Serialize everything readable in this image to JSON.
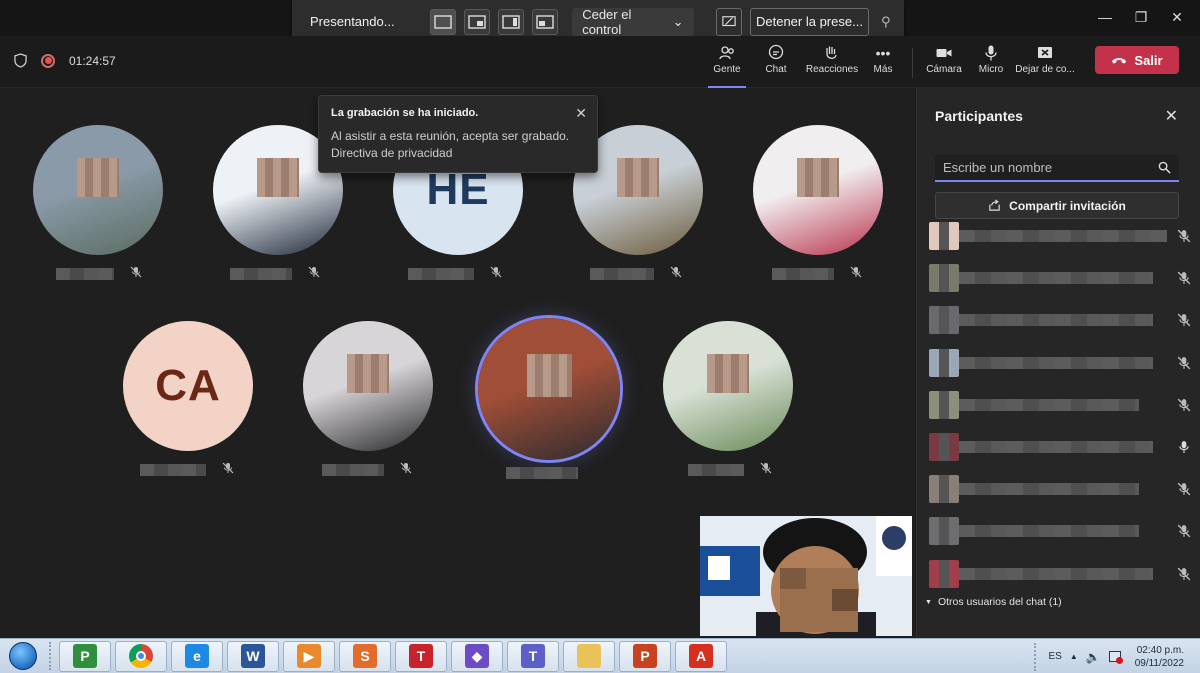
{
  "presenter_bar": {
    "presenting_label": "Presentando...",
    "give_control_label": "Ceder el control",
    "stop_label": "Detener la prese..."
  },
  "header": {
    "timer": "01:24:57",
    "tools": [
      {
        "label": "Gente",
        "icon": "people-icon"
      },
      {
        "label": "Chat",
        "icon": "chat-icon"
      },
      {
        "label": "Reacciones",
        "icon": "reactions-icon"
      },
      {
        "label": "Más",
        "icon": "more-icon"
      }
    ],
    "devices": [
      {
        "label": "Cámara",
        "icon": "camera-icon"
      },
      {
        "label": "Micro",
        "icon": "mic-icon"
      },
      {
        "label": "Dejar de co...",
        "icon": "stop-sharing-icon"
      }
    ],
    "leave_label": "Salir"
  },
  "toast": {
    "title": "La grabación se ha iniciado.",
    "body": "Al asistir a esta reunión, acepta ser grabado.",
    "link": "Directiva de privacidad"
  },
  "stage": {
    "tiles": [
      {
        "type": "photo",
        "colors": [
          "#8a9aa8",
          "#5a6b60"
        ]
      },
      {
        "type": "photo",
        "colors": [
          "#eef2f6",
          "#1d2638"
        ]
      },
      {
        "type": "initials",
        "initials": "HE",
        "bg": "#d9e4f1",
        "fg": "#203a5e"
      },
      {
        "type": "photo",
        "colors": [
          "#c9cfd6",
          "#6a5a3a"
        ]
      },
      {
        "type": "photo",
        "colors": [
          "#f1eef0",
          "#b8324b"
        ]
      },
      {
        "type": "initials",
        "initials": "CA",
        "bg": "#f2d3c5",
        "fg": "#6a2715"
      },
      {
        "type": "photo",
        "colors": [
          "#d8d5d8",
          "#262628"
        ]
      },
      {
        "type": "photo",
        "colors": [
          "#a04e37",
          "#2b2b2e"
        ]
      },
      {
        "type": "photo",
        "colors": [
          "#d9e1d6",
          "#6a8a58"
        ]
      }
    ]
  },
  "panel": {
    "title": "Participantes",
    "search_placeholder": "Escribe un nombre",
    "share_invite_label": "Compartir invitación",
    "participants": [
      {
        "avatar": "#e0c8bd",
        "mic": "off"
      },
      {
        "avatar": "#7a7a6a",
        "mic": "off"
      },
      {
        "avatar": "#6a6a6e",
        "mic": "off"
      },
      {
        "avatar": "#9aa8b6",
        "mic": "off"
      },
      {
        "avatar": "#8c8f7a",
        "mic": "off"
      },
      {
        "avatar": "#7a3a44",
        "mic": "on"
      },
      {
        "avatar": "#8a7f78",
        "mic": "off"
      },
      {
        "avatar": "#6e6e70",
        "mic": "off"
      },
      {
        "avatar": "#a03f4a",
        "mic": "off"
      }
    ],
    "chat_users_label": "Otros usuarios del chat (1)"
  },
  "taskbar": {
    "apps": [
      {
        "icon": "project-icon",
        "letter": "P",
        "bg": "#2f8f3d"
      },
      {
        "icon": "chrome-icon",
        "letter": "",
        "bg": "#db4437"
      },
      {
        "icon": "ie-icon",
        "letter": "e",
        "bg": "#1e88e5"
      },
      {
        "icon": "word-icon",
        "letter": "W",
        "bg": "#2b579a"
      },
      {
        "icon": "media-icon",
        "letter": "▶",
        "bg": "#e8892b"
      },
      {
        "icon": "slides-icon",
        "letter": "S",
        "bg": "#e36c2b"
      },
      {
        "icon": "t-app-icon",
        "letter": "T",
        "bg": "#c8222a"
      },
      {
        "icon": "vpn-icon",
        "letter": "◆",
        "bg": "#6b4cc4"
      },
      {
        "icon": "teams-icon",
        "letter": "T",
        "bg": "#5b5fc7"
      },
      {
        "icon": "explorer-icon",
        "letter": "",
        "bg": "#e9c35a"
      },
      {
        "icon": "powerpoint-icon",
        "letter": "P",
        "bg": "#c9421f"
      },
      {
        "icon": "acrobat-icon",
        "letter": "A",
        "bg": "#d62e1f"
      }
    ],
    "lang": "ES",
    "time": "02:40 p.m.",
    "date": "09/11/2022"
  }
}
